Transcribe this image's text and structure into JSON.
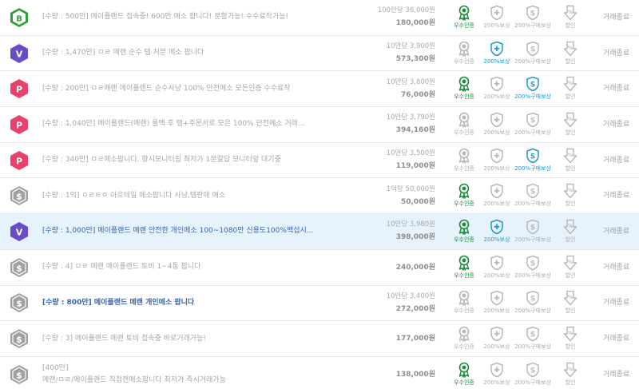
{
  "colors": {
    "grade_B": "#2ea03b",
    "grade_V": "#6a4cc8",
    "grade_P": "#e8416a",
    "grade_S": "#a0a0a0",
    "verified_green": "#1a8c3a",
    "protect_blue": "#2196d3",
    "inactive_gray": "#b8b8b8",
    "highlight_row": "#e6f3fc"
  },
  "icon_names": {
    "verify": "award-ribbon-icon",
    "protect": "shield-plus-icon",
    "buy_protect": "shield-s-icon",
    "discount": "discount-arrow-icon"
  },
  "labels": {
    "verify": "우수인증",
    "protect": "200%보상",
    "buy_protect": "200%구매보상",
    "discount": "할인"
  },
  "listings": [
    {
      "grade": "B",
      "title": "[수량 : 500만] 메이플랜드 접속중! 600만 메소 팝니다! 분할가능! 수수료작가능!",
      "title2": "",
      "unit_price": "100만당 36,000원",
      "total": "180,000원",
      "verify": true,
      "protect": false,
      "buy_protect": false,
      "status": "거래종료",
      "highlight": false,
      "strong": false
    },
    {
      "grade": "V",
      "title": "[수량 : 1,470만] ㅁㄹ 메랜 순수 템 처분 메소 팝니다",
      "title2": "",
      "unit_price": "10만당 3,900원",
      "total": "573,300원",
      "verify": false,
      "protect": true,
      "buy_protect": false,
      "status": "거래종료",
      "highlight": false,
      "strong": false
    },
    {
      "grade": "P",
      "title": "[수량 : 200만] ㅁㄹ메랜 메이플랜드 순수사냥 100% 안전메소 모든인증 수수료작",
      "title2": "",
      "unit_price": "10만당 3,800원",
      "total": "76,000원",
      "verify": true,
      "protect": false,
      "buy_protect": true,
      "status": "거래종료",
      "highlight": false,
      "strong": false
    },
    {
      "grade": "P",
      "title": "[수량 : 1,040만] 메이플랜드(메랜) 룰백 후 템+주문서로 모은 100% 안전메소 거래...",
      "title2": "",
      "unit_price": "10만당 3,790원",
      "total": "394,160원",
      "verify": false,
      "protect": false,
      "buy_protect": false,
      "status": "거래종료",
      "highlight": false,
      "strong": false
    },
    {
      "grade": "P",
      "title": "[수량 : 340만] ㅁㄹ메소팝니다. 항시모니터링 최저가 1분칼답 모니터앞 대기중",
      "title2": "",
      "unit_price": "10만당 3,500원",
      "total": "119,000원",
      "verify": false,
      "protect": false,
      "buy_protect": true,
      "status": "거래종료",
      "highlight": false,
      "strong": false
    },
    {
      "grade": "S",
      "title": "[수량 : 1억] ㅇㄹㅌㅇ 아르테일 메소팝니다 사냥,템판매 메소",
      "title2": "",
      "unit_price": "1억당 50,000원",
      "total": "50,000원",
      "verify": true,
      "protect": false,
      "buy_protect": false,
      "status": "거래종료",
      "highlight": false,
      "strong": false
    },
    {
      "grade": "V",
      "title": "[수량 : 1,000만] 메이플랜드 메랜 안전한 개인메소 100~1080만 신용도100%백섭시...",
      "title2": "",
      "unit_price": "10만당 3,980원",
      "total": "398,000원",
      "verify": true,
      "protect": true,
      "buy_protect": false,
      "status": "거래종료",
      "highlight": true,
      "strong": false
    },
    {
      "grade": "S",
      "title": "[수량 : 4] ㅁㄹ 메랜 메이플랜드 토비 1~4통 팝니다",
      "title2": "",
      "unit_price": "",
      "total": "240,000원",
      "verify": true,
      "protect": false,
      "buy_protect": false,
      "status": "거래종료",
      "highlight": false,
      "strong": false
    },
    {
      "grade": "S",
      "title": "[수량 : 800만] 메이플랜드 메랜 개인메소 팝니다",
      "title2": "",
      "unit_price": "10만당 3,400원",
      "total": "272,000원",
      "verify": false,
      "protect": false,
      "buy_protect": false,
      "status": "거래종료",
      "highlight": false,
      "strong": true
    },
    {
      "grade": "S",
      "title": "[수량 : 3] 메이플랜드 메랜 토비 접속중 바로거래가능!",
      "title2": "",
      "unit_price": "",
      "total": "177,000원",
      "verify": false,
      "protect": false,
      "buy_protect": false,
      "status": "거래종료",
      "highlight": false,
      "strong": false
    },
    {
      "grade": "S",
      "title": "[400만]",
      "title2": "메랜/ㅁㄹ/메이플랜드 직접캔메소팝니다 최저가 즉시거래가능",
      "unit_price": "",
      "total": "138,000원",
      "verify": true,
      "protect": false,
      "buy_protect": false,
      "status": "거래종료",
      "highlight": false,
      "strong": false
    }
  ]
}
